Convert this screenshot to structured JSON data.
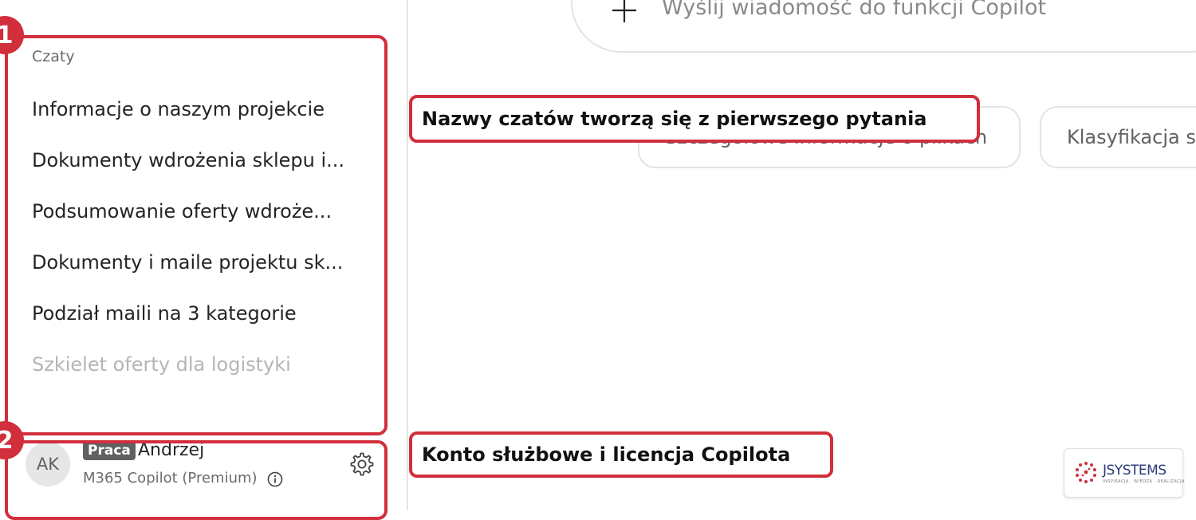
{
  "sidebar": {
    "section_title": "Czaty",
    "chats": [
      {
        "label": "Informacje o naszym projekcie"
      },
      {
        "label": "Dokumenty wdrożenia sklepu i..."
      },
      {
        "label": "Podsumowanie oferty wdroże..."
      },
      {
        "label": "Dokumenty i maile projektu sk..."
      },
      {
        "label": "Podział maili na 3 kategorie"
      },
      {
        "label": "Szkielet oferty dla logistyki"
      }
    ],
    "account": {
      "avatar_initials": "AK",
      "badge": "Praca",
      "name": "Andrzej",
      "license": "M365 Copilot (Premium)",
      "info_icon": "info-icon",
      "settings_icon": "gear-icon"
    }
  },
  "main": {
    "composer": {
      "placeholder": "Wyślij wiadomość do funkcji Copilot",
      "add_icon": "plus-icon"
    },
    "suggestions": [
      {
        "label": "Szczegółowe informacje o plikach"
      },
      {
        "label": "Klasyfikacja s"
      }
    ]
  },
  "annotations": {
    "callout_1": "1",
    "callout_2": "2",
    "label_chats": "Nazwy czatów tworzą się z pierwszego pytania",
    "label_account": "Konto służbowe i licencja Copilota",
    "accent_color": "#d12f3b"
  },
  "watermark": {
    "brand": "JSYSTEMS",
    "tagline": "INSPIRACJA · WIEDZA · REALIZACJA"
  }
}
